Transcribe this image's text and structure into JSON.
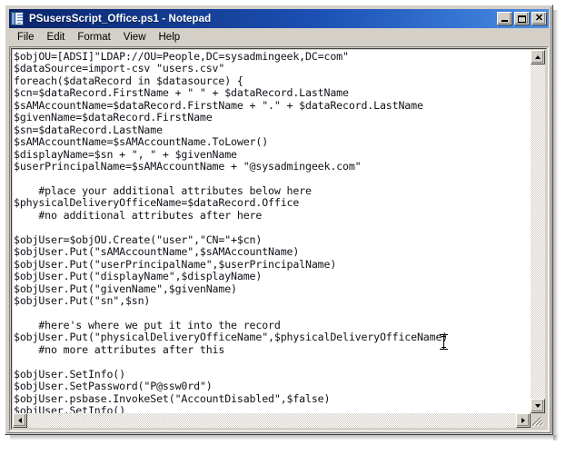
{
  "window": {
    "title": "PSusersScript_Office.ps1 - Notepad",
    "icon": "notepad-icon",
    "controls": {
      "minimize_label": "_",
      "maximize_label": "□",
      "close_label": "✕"
    }
  },
  "menu": {
    "items": [
      {
        "label": "File"
      },
      {
        "label": "Edit"
      },
      {
        "label": "Format"
      },
      {
        "label": "View"
      },
      {
        "label": "Help"
      }
    ]
  },
  "editor": {
    "content": "$objOU=[ADSI]\"LDAP://OU=People,DC=sysadmingeek,DC=com\"\n$dataSource=import-csv \"users.csv\"\nforeach($dataRecord in $datasource) {\n$cn=$dataRecord.FirstName + \" \" + $dataRecord.LastName\n$sAMAccountName=$dataRecord.FirstName + \".\" + $dataRecord.LastName\n$givenName=$dataRecord.FirstName\n$sn=$dataRecord.LastName\n$sAMAccountName=$sAMAccountName.ToLower()\n$displayName=$sn + \", \" + $givenName\n$userPrincipalName=$sAMAccountName + \"@sysadmingeek.com\"\n\n    #place your additional attributes below here\n$physicalDeliveryOfficeName=$dataRecord.Office\n    #no additional attributes after here\n\n$objUser=$objOU.Create(\"user\",\"CN=\"+$cn)\n$objUser.Put(\"sAMAccountName\",$sAMAccountName)\n$objUser.Put(\"userPrincipalName\",$userPrincipalName)\n$objUser.Put(\"displayName\",$displayName)\n$objUser.Put(\"givenName\",$givenName)\n$objUser.Put(\"sn\",$sn)\n\n    #here's where we put it into the record\n$objUser.Put(\"physicalDeliveryOfficeName\",$physicalDeliveryOfficeName)\n    #no more attributes after this\n\n$objUser.SetInfo()\n$objUser.SetPassword(\"P@ssw0rd\")\n$objUser.psbase.InvokeSet(\"AccountDisabled\",$false)\n$objUser.SetInfo()\n}"
  },
  "scrollbars": {
    "vertical": {
      "up_icon": "arrow-up-icon",
      "down_icon": "arrow-down-icon"
    },
    "horizontal": {
      "left_icon": "arrow-left-icon",
      "right_icon": "arrow-right-icon"
    }
  },
  "cursor": {
    "type": "i-beam-cursor"
  },
  "colors": {
    "title_gradient_start": "#0a246a",
    "title_gradient_end": "#4d8fe0",
    "window_face": "#d4d0c8",
    "editor_background": "#ffffff",
    "editor_text": "#101018"
  }
}
